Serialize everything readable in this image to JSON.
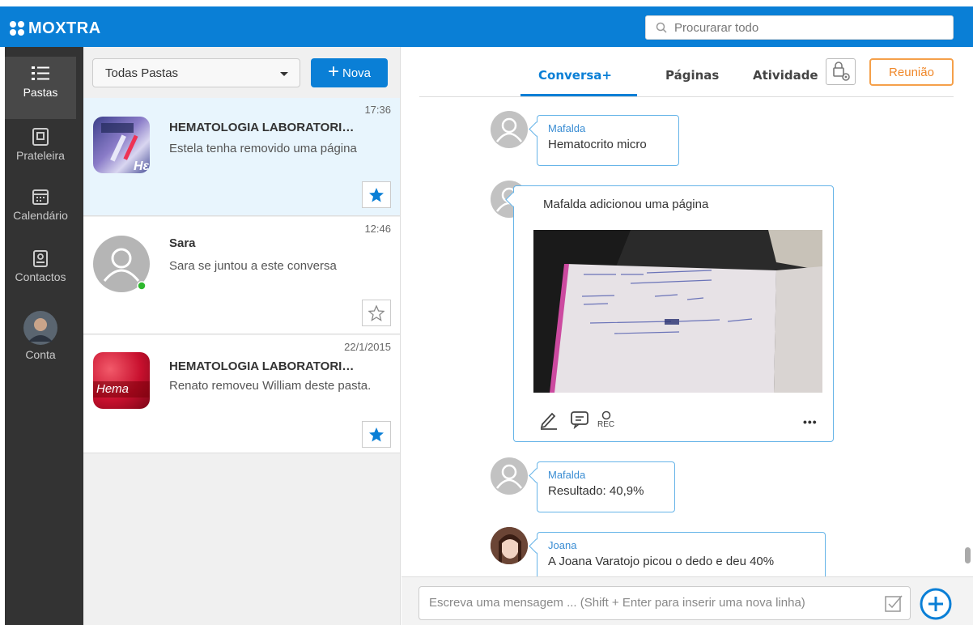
{
  "app": {
    "brand": "MOXTRA",
    "accent": "#0a7fd6"
  },
  "search": {
    "placeholder": "Procurarar todo"
  },
  "nav": {
    "items": [
      {
        "label": "Pastas",
        "icon": "list-icon",
        "active": true
      },
      {
        "label": "Prateleira",
        "icon": "shelf-icon"
      },
      {
        "label": "Calendário",
        "icon": "calendar-icon"
      },
      {
        "label": "Contactos",
        "icon": "contacts-icon"
      },
      {
        "label": "Conta",
        "icon": "account-avatar"
      }
    ]
  },
  "folders": {
    "filter": "Todas Pastas",
    "new_label": "Nova",
    "list": [
      {
        "time": "17:36",
        "title": "HEMATOLOGIA LABORATORI…",
        "preview": "Estela tenha removido uma página",
        "starred": true
      },
      {
        "time": "12:46",
        "title": "Sara",
        "preview": "Sara se juntou a este conversa",
        "starred": false,
        "online": true
      },
      {
        "time": "22/1/2015",
        "title": "HEMATOLOGIA LABORATORI…",
        "preview": "Renato removeu William deste pasta.",
        "starred": true,
        "thumb_text": "Hema"
      }
    ]
  },
  "chat": {
    "tabs": [
      "Conversa+",
      "Páginas",
      "Atividade"
    ],
    "active_tab": "Conversa+",
    "meeting_label": "Reunião",
    "messages": [
      {
        "author": "Mafalda",
        "text": "Hematocrito micro"
      },
      {
        "text": "Mafalda adicionou uma página",
        "tool_rec": "REC",
        "more": "•••"
      },
      {
        "author": "Mafalda",
        "text": "Resultado: 40,9%"
      },
      {
        "author": "Joana",
        "text": "A Joana Varatojo picou o dedo e deu 40%"
      }
    ],
    "composer_placeholder": "Escreva uma mensagem ... (Shift + Enter para inserir uma nova linha)"
  }
}
